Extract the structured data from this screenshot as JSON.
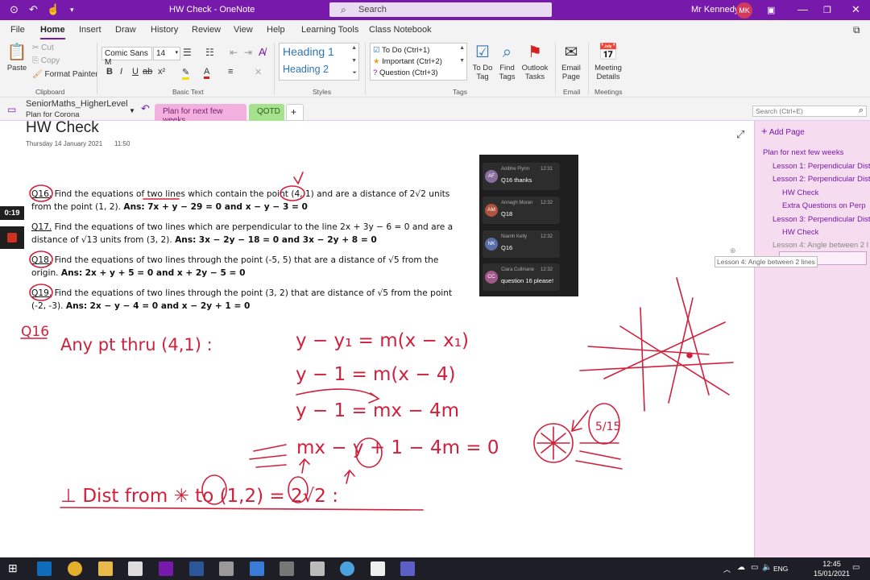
{
  "titlebar": {
    "title": "HW Check  -  OneNote",
    "search_placeholder": "Search",
    "user": "Mr Kennedy",
    "avatar": "MK"
  },
  "menu": {
    "tabs": [
      "File",
      "Home",
      "Insert",
      "Draw",
      "History",
      "Review",
      "View",
      "Help",
      "Learning Tools",
      "Class Notebook"
    ],
    "active": "Home"
  },
  "ribbon": {
    "clipboard": {
      "paste": "Paste",
      "cut": "Cut",
      "copy": "Copy",
      "format_painter": "Format Painter",
      "group": "Clipboard"
    },
    "basic_text": {
      "font": "Comic Sans M",
      "size": "14",
      "group": "Basic Text"
    },
    "styles": {
      "heading1": "Heading 1",
      "heading2": "Heading 2",
      "group": "Styles"
    },
    "tags": {
      "todo": "To Do (Ctrl+1)",
      "important": "Important (Ctrl+2)",
      "question": "Question (Ctrl+3)",
      "todo_tag": "To Do Tag",
      "find_tags": "Find Tags",
      "outlook_tasks": "Outlook Tasks",
      "group": "Tags"
    },
    "email": {
      "label": "Email Page",
      "group": "Email"
    },
    "meetings": {
      "label": "Meeting Details",
      "group": "Meetings"
    }
  },
  "notebook": {
    "name": "SeniorMaths_HigherLevel",
    "section": "Plan for Corona",
    "section_tabs": [
      "Plan for next few weeks",
      "QOTD"
    ],
    "search_placeholder": "Search (Ctrl+E)"
  },
  "page": {
    "title": "HW Check",
    "date": "Thursday 14 January 2021",
    "time": "11:50",
    "questions": [
      {
        "id": "Q16.",
        "text": "Find the equations of two lines which contain the point (4, 1) and are a distance of 2√2 units from the point (1, 2).",
        "ans_label": "Ans:",
        "answer": "7x + y − 29 = 0 and x − y − 3 = 0"
      },
      {
        "id": "Q17.",
        "text": "Find the equations of two lines which are perpendicular to the line 2x + 3y − 6 = 0 and are a distance of √13 units from (3, 2).",
        "ans_label": "Ans:",
        "answer": "3x − 2y − 18 = 0 and 3x − 2y + 8 = 0"
      },
      {
        "id": "Q18.",
        "text": "Find the equations of two lines through the point (-5, 5) that are a distance of √5 from the origin.",
        "ans_label": "Ans:",
        "answer": "2x + y + 5 = 0 and x + 2y − 5 = 0"
      },
      {
        "id": "Q19.",
        "text": "Find the equations of two lines through the point (3, 2) that are distance of √5 from the point (-2, -3).",
        "ans_label": "Ans:",
        "answer": "2x − y − 4 = 0 and x − 2y + 1 = 0"
      }
    ],
    "handwriting": {
      "q_label": "Q16",
      "line1": "Any pt thru (4,1) :",
      "eq1": "y − y₁ = m(x − x₁)",
      "eq2": "y − 1 = m(x − 4)",
      "eq3": "y − 1 = mx − 4m",
      "eq4": "mx − y + 1 − 4m = 0",
      "perp": "⊥ Dist from ✳ to (1,2) = 2√2 :",
      "fraction": "5/15"
    }
  },
  "chat": {
    "messages": [
      {
        "initials": "AF",
        "name": "Aoibhe Flynn",
        "time": "12:31",
        "text": "Q16 thanks",
        "color": "#8a6f9e"
      },
      {
        "initials": "AM",
        "name": "Annagh Moran",
        "time": "12:32",
        "text": "Q18",
        "color": "#b0533c"
      },
      {
        "initials": "NK",
        "name": "Niamh Kelly",
        "time": "12:32",
        "text": "Q16",
        "color": "#5a6fa8"
      },
      {
        "initials": "CC",
        "name": "Ciara Cullinane",
        "time": "12:32",
        "text": "question 16 please!",
        "color": "#a35a8a"
      }
    ]
  },
  "sidebar": {
    "add_page": "Add Page",
    "pages": [
      {
        "label": "Plan for next few weeks",
        "level": 0
      },
      {
        "label": "Lesson 1: Perpendicular Dist",
        "level": 1
      },
      {
        "label": "Lesson 2: Perpendicular Dist",
        "level": 1
      },
      {
        "label": "HW Check",
        "level": 2
      },
      {
        "label": "Extra Questions on Perp",
        "level": 2
      },
      {
        "label": "Lesson 3: Perpendicular Dist",
        "level": 1
      },
      {
        "label": "HW Check",
        "level": 2
      },
      {
        "label": "Lesson 4: Angle between 2 l",
        "level": 1
      }
    ],
    "tooltip": "Lesson 4: Angle between 2 lines"
  },
  "timer": "0:19",
  "taskbar": {
    "lang": "ENG",
    "time": "12:45",
    "date": "15/01/2021"
  }
}
